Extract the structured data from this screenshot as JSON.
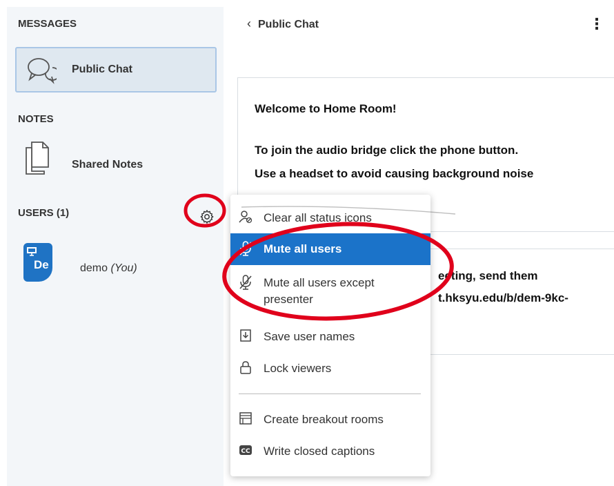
{
  "sidebar": {
    "messages_title": "MESSAGES",
    "public_chat_label": "Public Chat",
    "notes_title": "NOTES",
    "shared_notes_label": "Shared Notes",
    "users_title": "USERS (1)",
    "user": {
      "initials": "De",
      "name": "demo",
      "you_suffix": "(You)"
    }
  },
  "chat": {
    "header": "Public Chat",
    "back_glyph": "‹",
    "more_glyph": "⋮",
    "welcome": {
      "line1": "Welcome to Home Room!",
      "line2": "To join the audio bridge click the phone button.",
      "line3": "Use a headset to avoid causing background noise"
    },
    "invite": {
      "line1": "eeting, send them",
      "line2": "t.hksyu.edu/b/dem-9kc-"
    }
  },
  "menu": {
    "clear_status": "Clear all status icons",
    "mute_all": "Mute all users",
    "mute_except_line1": "Mute all users except",
    "mute_except_line2": "presenter",
    "save_names": "Save user names",
    "lock_viewers": "Lock viewers",
    "breakout": "Create breakout rooms",
    "captions": "Write closed captions",
    "captions_icon_text": "CC"
  },
  "colors": {
    "accent": "#1b73c9",
    "annotation_red": "#e0001b"
  }
}
